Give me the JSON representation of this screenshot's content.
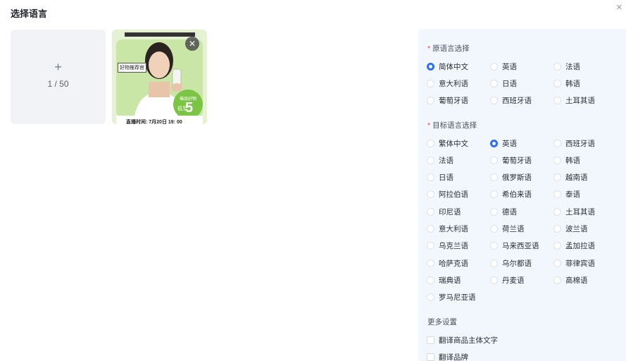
{
  "dialog": {
    "title": "选择语言",
    "close_glyph": "×"
  },
  "upload": {
    "plus_glyph": "+",
    "count": "1 / 50"
  },
  "thumbnail": {
    "remove_glyph": "✕",
    "tag_text": "好物推荐官",
    "badge_line1": "爆品好物",
    "badge_line2": "低至",
    "badge_number": "5",
    "footer_text": "直播时间: 7月20日 19: 00",
    "colors": {
      "bg": "#dff0c9",
      "accent": "#7cc444"
    }
  },
  "source_language": {
    "label": "原语言选择",
    "required_mark": "*",
    "options": [
      "简体中文",
      "英语",
      "法语",
      "意大利语",
      "日语",
      "韩语",
      "葡萄牙语",
      "西班牙语",
      "土耳其语"
    ],
    "selected": "简体中文"
  },
  "target_language": {
    "label": "目标语言选择",
    "required_mark": "*",
    "options": [
      "繁体中文",
      "英语",
      "西班牙语",
      "法语",
      "葡萄牙语",
      "韩语",
      "日语",
      "俄罗斯语",
      "越南语",
      "阿拉伯语",
      "希伯来语",
      "泰语",
      "印尼语",
      "德语",
      "土耳其语",
      "意大利语",
      "荷兰语",
      "波兰语",
      "乌克兰语",
      "马来西亚语",
      "孟加拉语",
      "哈萨克语",
      "乌尔都语",
      "菲律宾语",
      "瑞典语",
      "丹麦语",
      "高棉语",
      "罗马尼亚语"
    ],
    "selected": "英语"
  },
  "more_settings": {
    "label": "更多设置",
    "options": [
      "翻译商品主体文字",
      "翻译品牌"
    ]
  },
  "colors": {
    "accent": "#2e6df5",
    "panel_bg": "#f2f6fd",
    "required": "#e8453c"
  }
}
